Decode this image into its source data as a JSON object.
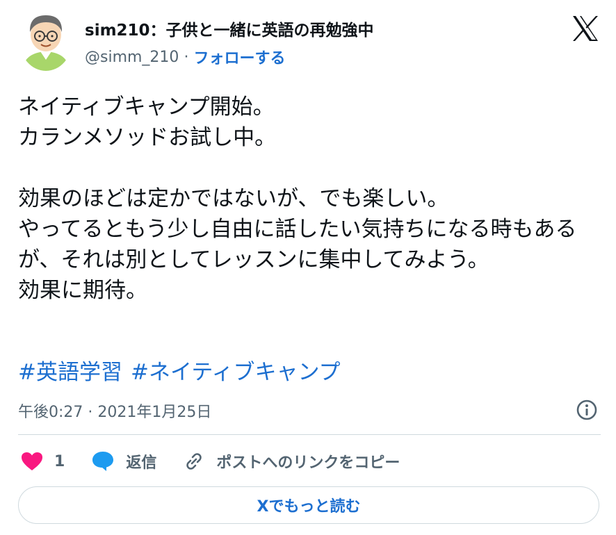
{
  "author": {
    "display_name": "sim210：子供と一緒に英語の再勉強中",
    "handle": "@simm_210",
    "separator": "·",
    "follow_label": "フォローする",
    "avatar_icon": "cartoon-avatar-icon"
  },
  "brand": {
    "logo_icon": "x-logo-icon"
  },
  "tweet": {
    "text": "ネイティブキャンプ開始。\nカランメソッドお試し中。\n\n効果のほどは定かではないが、でも楽しい。\nやってるともう少し自由に話したい気持ちになる時もあるが、それは別としてレッスンに集中してみよう。\n効果に期待。",
    "hashtags": [
      "#英語学習",
      "#ネイティブキャンプ"
    ],
    "timestamp": "午後0:27 · 2021年1月25日"
  },
  "actions": {
    "like_count": "1",
    "reply_label": "返信",
    "copy_link_label": "ポストへのリンクをコピー"
  },
  "footer": {
    "read_more_label": "Xでもっと読む"
  },
  "colors": {
    "accent": "#1d6fd0",
    "like": "#f91880",
    "reply": "#1d9bf0",
    "secondary_text": "#536471"
  }
}
